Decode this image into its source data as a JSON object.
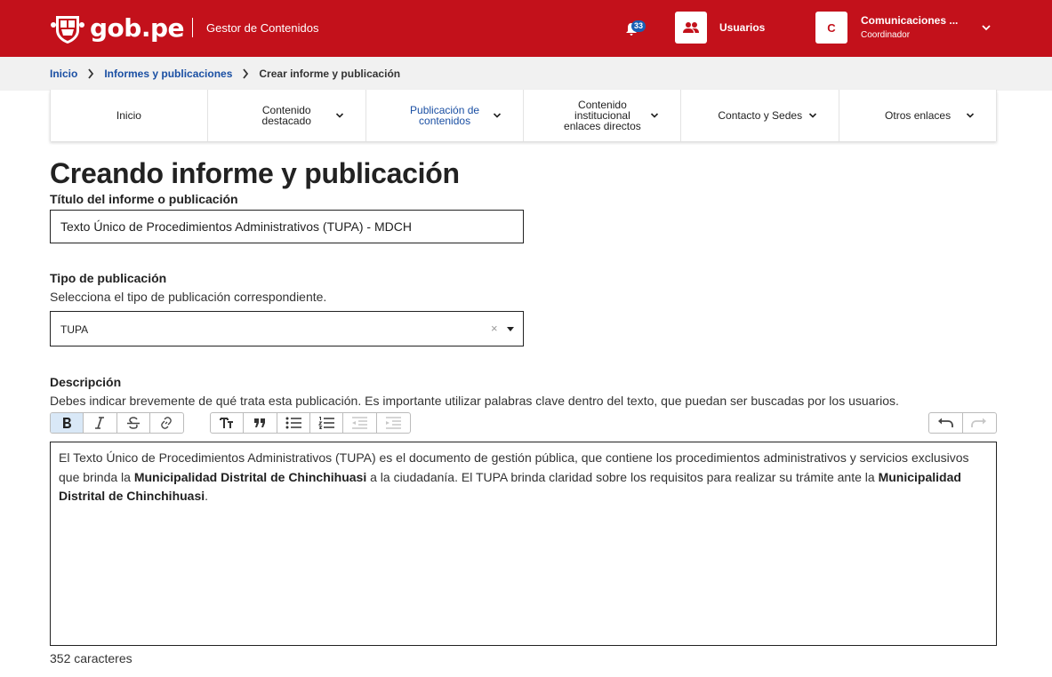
{
  "header": {
    "brand": "gob.pe",
    "app_title": "Gestor de Contenidos",
    "notifications_count": "33",
    "users_label": "Usuarios",
    "user": {
      "initial": "C",
      "name": "Comunicaciones ...",
      "role": "Coordinador"
    }
  },
  "breadcrumb": [
    {
      "label": "Inicio"
    },
    {
      "label": "Informes y publicaciones"
    },
    {
      "label": "Crear informe y publicación"
    }
  ],
  "nav_tabs": [
    {
      "lines": [
        "Inicio"
      ],
      "has_menu": false,
      "active": false
    },
    {
      "lines": [
        "Contenido",
        "destacado"
      ],
      "has_menu": true,
      "active": false
    },
    {
      "lines": [
        "Publicación de",
        "contenidos"
      ],
      "has_menu": true,
      "active": true
    },
    {
      "lines": [
        "Contenido",
        "institucional",
        "enlaces directos"
      ],
      "has_menu": true,
      "active": false
    },
    {
      "lines": [
        "Contacto y Sedes"
      ],
      "has_menu": true,
      "active": false
    },
    {
      "lines": [
        "Otros enlaces"
      ],
      "has_menu": true,
      "active": false
    }
  ],
  "page_title": "Creando informe y publicación",
  "form": {
    "title_label": "Título del informe o publicación",
    "title_value": "Texto Único de Procedimientos Administrativos (TUPA) - MDCH",
    "type_label": "Tipo de publicación",
    "type_help": "Selecciona el tipo de publicación correspondiente.",
    "type_value": "TUPA",
    "type_clear": "×",
    "description_label": "Descripción",
    "description_help": "Debes indicar brevemente de qué trata esta publicación. Es importante utilizar palabras clave dentro del texto, que puedan ser buscadas por los usuarios.",
    "description_parts": [
      {
        "text": "El Texto Único de Procedimientos Administrativos (TUPA) es el documento de gestión pública, que contiene los procedimientos administrativos y servicios exclusivos que brinda la ",
        "bold": false
      },
      {
        "text": "Municipalidad Distrital de Chinchihuasi",
        "bold": true
      },
      {
        "text": " a la ciudadanía. El TUPA brinda claridad sobre los requisitos para realizar su trámite ante la ",
        "bold": false
      },
      {
        "text": "Municipalidad Distrital de Chinchihuasi",
        "bold": true
      },
      {
        "text": ".",
        "bold": false
      }
    ],
    "char_count": "352 caracteres"
  },
  "toolbar": {
    "groups": [
      {
        "buttons": [
          {
            "icon": "bold-icon",
            "state": "on"
          },
          {
            "icon": "italic-icon",
            "state": "normal"
          },
          {
            "icon": "strikethrough-icon",
            "state": "normal"
          },
          {
            "icon": "link-icon",
            "state": "normal"
          }
        ]
      },
      {
        "buttons": [
          {
            "icon": "heading-icon",
            "state": "normal"
          },
          {
            "icon": "quote-icon",
            "state": "normal"
          },
          {
            "icon": "bullet-list-icon",
            "state": "normal"
          },
          {
            "icon": "numbered-list-icon",
            "state": "normal"
          },
          {
            "icon": "outdent-icon",
            "state": "off"
          },
          {
            "icon": "indent-icon",
            "state": "off"
          }
        ]
      },
      {
        "buttons": [
          {
            "icon": "undo-icon",
            "state": "normal"
          },
          {
            "icon": "redo-icon",
            "state": "off"
          }
        ]
      }
    ]
  },
  "colors": {
    "brand_red": "#c3111b",
    "link_blue": "#1a4fa3",
    "badge_blue": "#1a5fb4",
    "active_tool": "#d9e8f7"
  }
}
